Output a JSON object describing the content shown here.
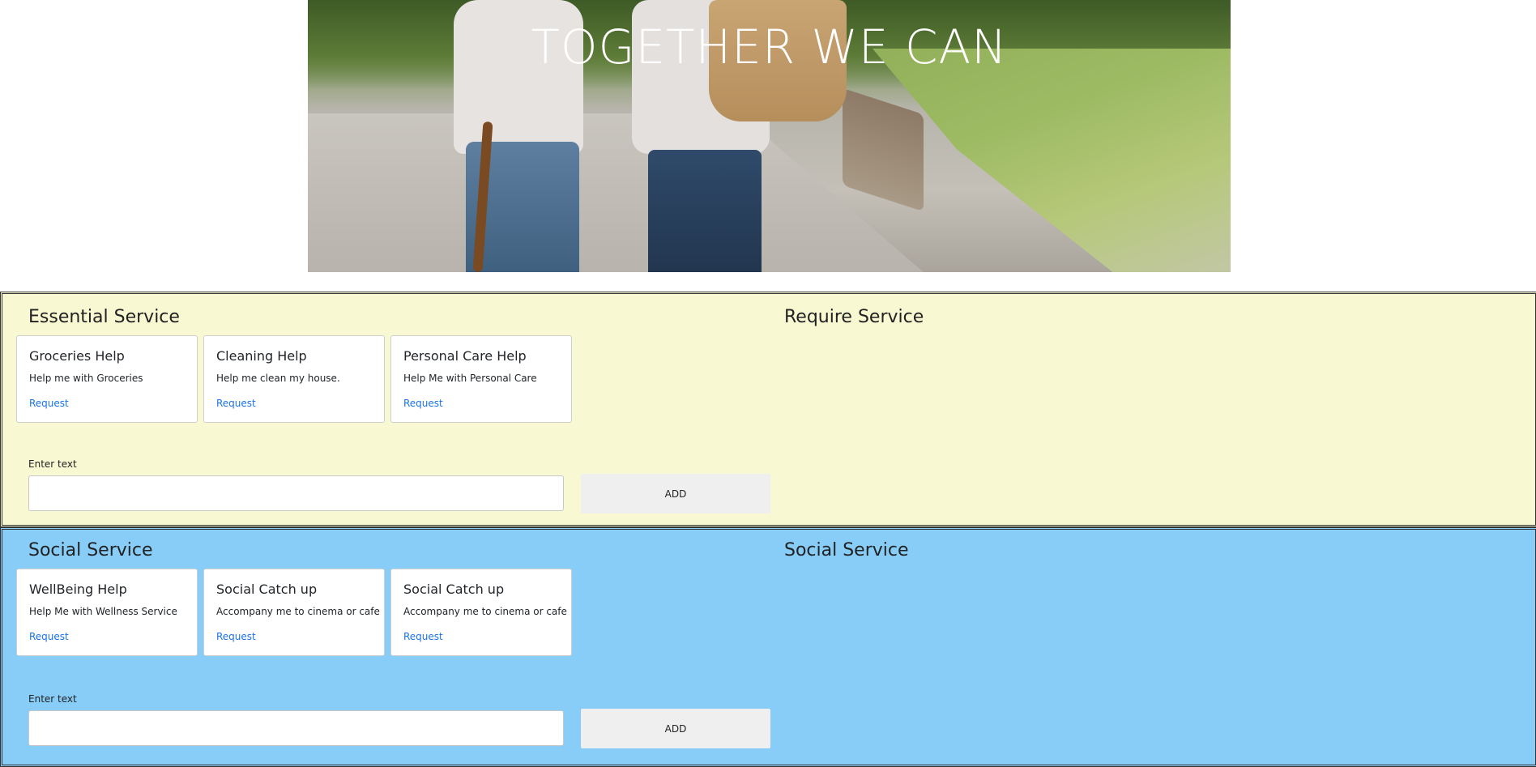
{
  "hero": {
    "title": "TOGETHER WE CAN"
  },
  "essential": {
    "title": "Essential Service",
    "side_title": "Require Service",
    "cards": [
      {
        "title": "Groceries Help",
        "text": "Help me with Groceries",
        "link": "Request"
      },
      {
        "title": "Cleaning Help",
        "text": "Help me clean my house.",
        "link": "Request"
      },
      {
        "title": "Personal Care Help",
        "text": "Help Me with Personal Care",
        "link": "Request"
      }
    ],
    "input_label": "Enter text",
    "input_value": "",
    "button_label": "ADD"
  },
  "social": {
    "title": "Social Service",
    "side_title": "Social Service",
    "cards": [
      {
        "title": "WellBeing Help",
        "text": "Help Me with Wellness Service",
        "link": "Request"
      },
      {
        "title": "Social Catch up",
        "text": "Accompany me to cinema or cafe",
        "link": "Request"
      },
      {
        "title": "Social Catch up",
        "text": "Accompany me to cinema or cafe",
        "link": "Request"
      }
    ],
    "input_label": "Enter text",
    "input_value": "",
    "button_label": "ADD"
  },
  "colors": {
    "essential_bg": "#f8f8d2",
    "social_bg": "#87cdf8",
    "link": "#1a73e8",
    "button_bg": "#efefef"
  }
}
